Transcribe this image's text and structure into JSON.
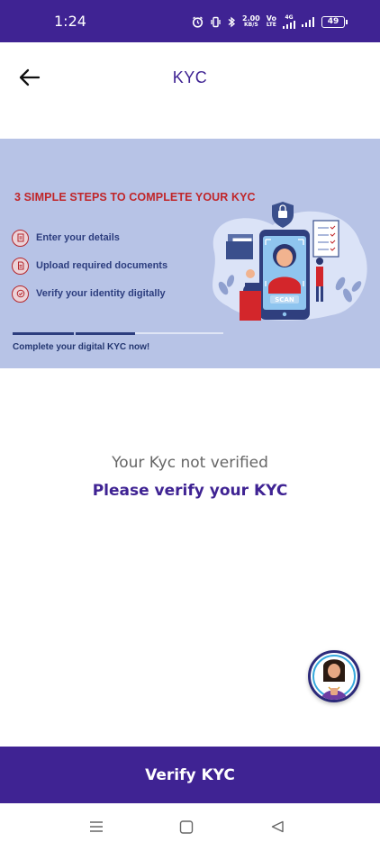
{
  "status_bar": {
    "time": "1:24",
    "speed_value": "2.00",
    "speed_unit": "KB/S",
    "volte_top": "Vo",
    "volte_bottom": "LTE",
    "network_top": "4G",
    "battery": "49"
  },
  "header": {
    "title": "KYC",
    "back_icon": "arrow-left-icon"
  },
  "banner": {
    "heading": "3 SIMPLE STEPS TO COMPLETE YOUR KYC",
    "steps": [
      {
        "label": "Enter your details",
        "icon": "edit-icon"
      },
      {
        "label": "Upload required documents",
        "icon": "document-icon"
      },
      {
        "label": "Verify your identity digitally",
        "icon": "check-icon"
      }
    ],
    "scan_label": "SCAN",
    "cta": "Complete your digital KYC now!",
    "progress": 0.58,
    "colors": {
      "background": "#b7c3e6",
      "heading": "#c0262a",
      "text": "#2c3d7e"
    }
  },
  "main": {
    "status_text": "Your Kyc not verified",
    "prompt_text": "Please verify your KYC"
  },
  "assistant": {
    "icon": "assistant-avatar-icon"
  },
  "footer": {
    "verify_label": "Verify KYC"
  },
  "nav": {
    "recents_icon": "menu-icon",
    "home_icon": "square-icon",
    "back_icon": "triangle-back-icon"
  },
  "colors": {
    "primary": "#3f2393",
    "muted": "#666666"
  }
}
